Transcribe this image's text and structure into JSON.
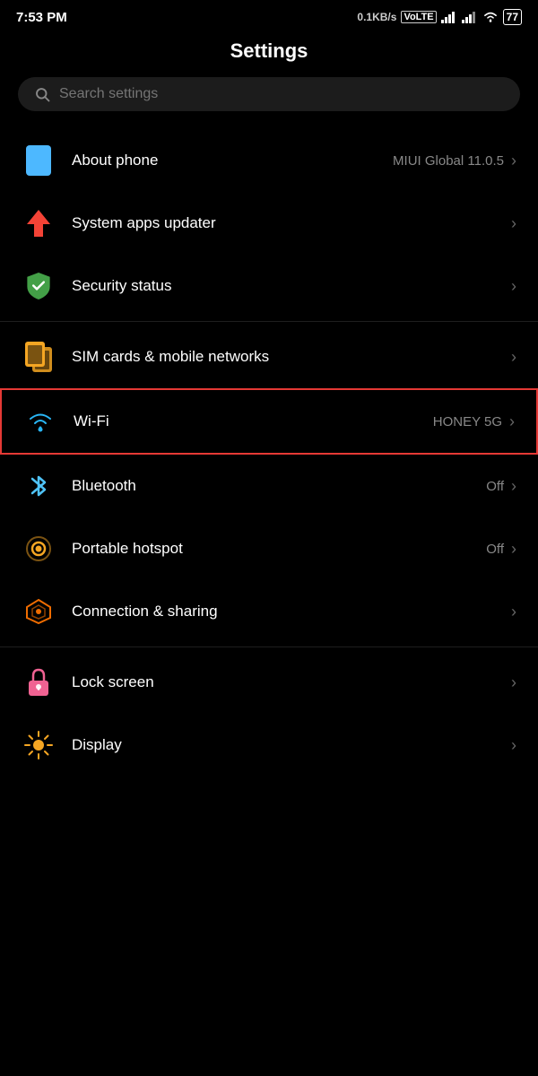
{
  "statusBar": {
    "time": "7:53 PM",
    "speed": "0.1KB/s",
    "networkType": "VoLTE",
    "battery": "77"
  },
  "pageTitle": "Settings",
  "search": {
    "placeholder": "Search settings"
  },
  "items": [
    {
      "id": "about-phone",
      "label": "About phone",
      "value": "MIUI Global 11.0.5",
      "icon": "phone-icon",
      "hasChevron": true
    },
    {
      "id": "system-apps-updater",
      "label": "System apps updater",
      "value": "",
      "icon": "update-icon",
      "hasChevron": true
    },
    {
      "id": "security-status",
      "label": "Security status",
      "value": "",
      "icon": "shield-icon",
      "hasChevron": true
    },
    {
      "id": "sim-cards",
      "label": "SIM cards & mobile networks",
      "value": "",
      "icon": "sim-icon",
      "hasChevron": true,
      "dividerBefore": true
    },
    {
      "id": "wifi",
      "label": "Wi-Fi",
      "value": "HONEY 5G",
      "icon": "wifi-icon",
      "hasChevron": true,
      "highlighted": true
    },
    {
      "id": "bluetooth",
      "label": "Bluetooth",
      "value": "Off",
      "icon": "bluetooth-icon",
      "hasChevron": true
    },
    {
      "id": "portable-hotspot",
      "label": "Portable hotspot",
      "value": "Off",
      "icon": "hotspot-icon",
      "hasChevron": true
    },
    {
      "id": "connection-sharing",
      "label": "Connection & sharing",
      "value": "",
      "icon": "connection-icon",
      "hasChevron": true
    },
    {
      "id": "lock-screen",
      "label": "Lock screen",
      "value": "",
      "icon": "lock-icon",
      "hasChevron": true,
      "dividerBefore": true
    },
    {
      "id": "display",
      "label": "Display",
      "value": "",
      "icon": "display-icon",
      "hasChevron": true
    }
  ]
}
